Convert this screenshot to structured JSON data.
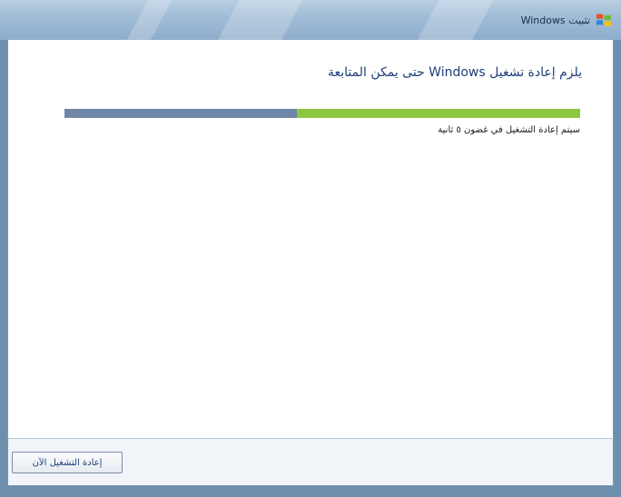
{
  "window": {
    "title": "تثبيت Windows",
    "icon": "windows-flag-icon"
  },
  "main": {
    "heading": "يلزم إعادة تشغيل Windows حتى يمكن المتابعة",
    "progress": 0.55,
    "status_text": "سيتم إعادة التشغيل في غضون ٥ ثانية"
  },
  "footer": {
    "restart_now_label": "إعادة التشغيل الآن"
  },
  "colors": {
    "progress_fill": "#8dc63f",
    "progress_track": "#6f86a6",
    "heading_text": "#1e3d7a",
    "window_frame": "#6f8fae"
  }
}
